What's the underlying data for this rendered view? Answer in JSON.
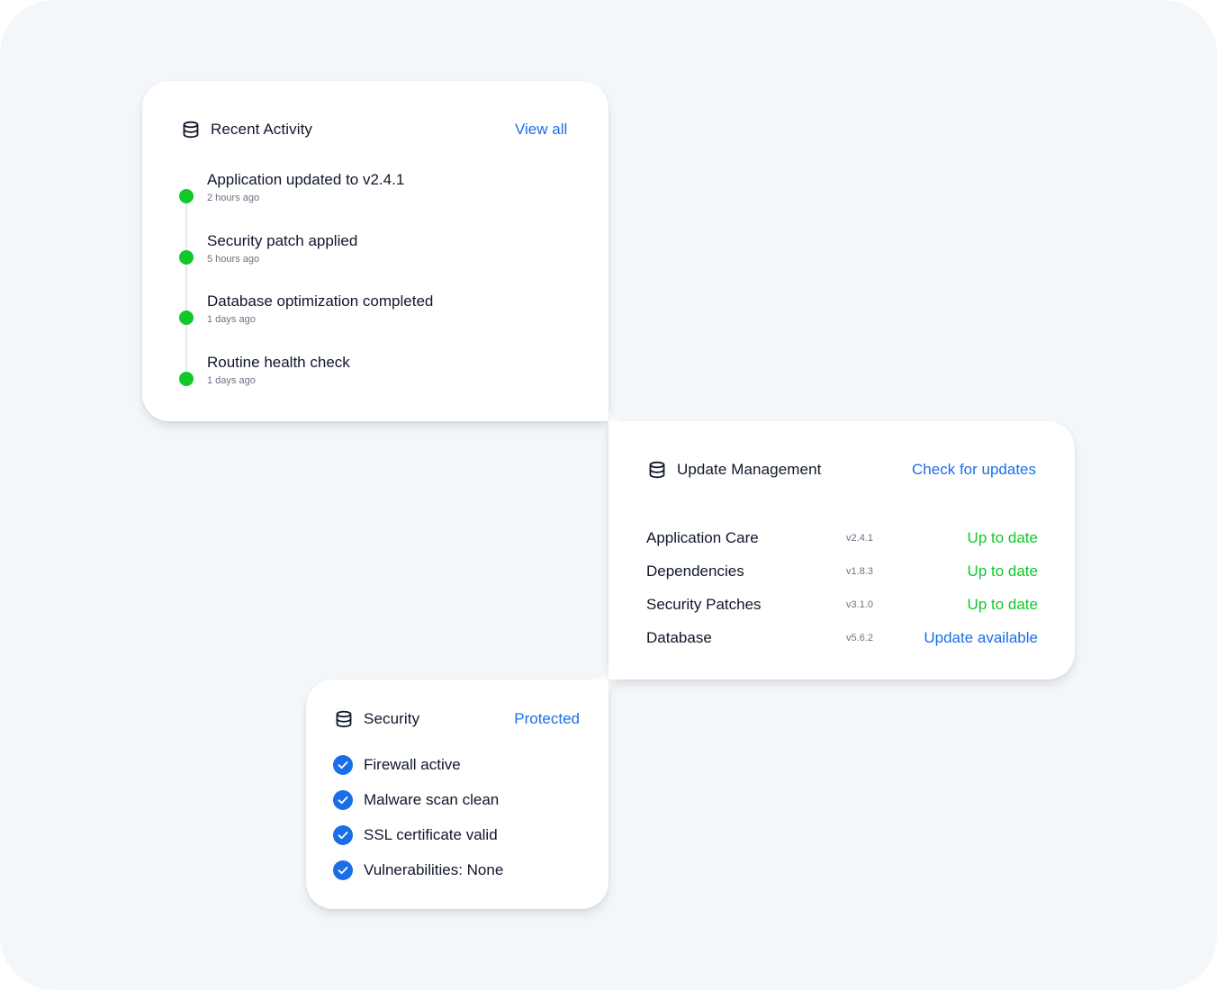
{
  "colors": {
    "background": "#f4f7fa",
    "card": "#ffffff",
    "accent_blue": "#1a6fe8",
    "success_green": "#10c82a",
    "text_primary": "#0f172a",
    "text_muted": "#6b7280"
  },
  "recent_activity": {
    "icon": "database-icon",
    "title": "Recent Activity",
    "action": "View all",
    "items": [
      {
        "title": "Application updated to v2.4.1",
        "time": "2 hours ago"
      },
      {
        "title": "Security patch applied",
        "time": "5 hours ago"
      },
      {
        "title": "Database optimization completed",
        "time": "1 days ago"
      },
      {
        "title": "Routine health check",
        "time": "1 days ago"
      }
    ]
  },
  "update_management": {
    "icon": "database-icon",
    "title": "Update Management",
    "action": "Check for updates",
    "rows": [
      {
        "name": "Application Care",
        "version": "v2.4.1",
        "status": "Up to date",
        "status_color": "#10c82a"
      },
      {
        "name": "Dependencies",
        "version": "v1.8.3",
        "status": "Up to date",
        "status_color": "#10c82a"
      },
      {
        "name": "Security Patches",
        "version": "v3.1.0",
        "status": "Up to date",
        "status_color": "#10c82a"
      },
      {
        "name": "Database",
        "version": "v5.6.2",
        "status": "Update available",
        "status_color": "#1a6fe8"
      }
    ]
  },
  "security": {
    "icon": "database-icon",
    "title": "Security",
    "status": "Protected",
    "checks": [
      {
        "label": "Firewall active",
        "icon": "check-circle-icon"
      },
      {
        "label": "Malware scan clean",
        "icon": "check-circle-icon"
      },
      {
        "label": "SSL certificate valid",
        "icon": "check-circle-icon"
      },
      {
        "label": "Vulnerabilities: None",
        "icon": "check-circle-icon"
      }
    ]
  }
}
